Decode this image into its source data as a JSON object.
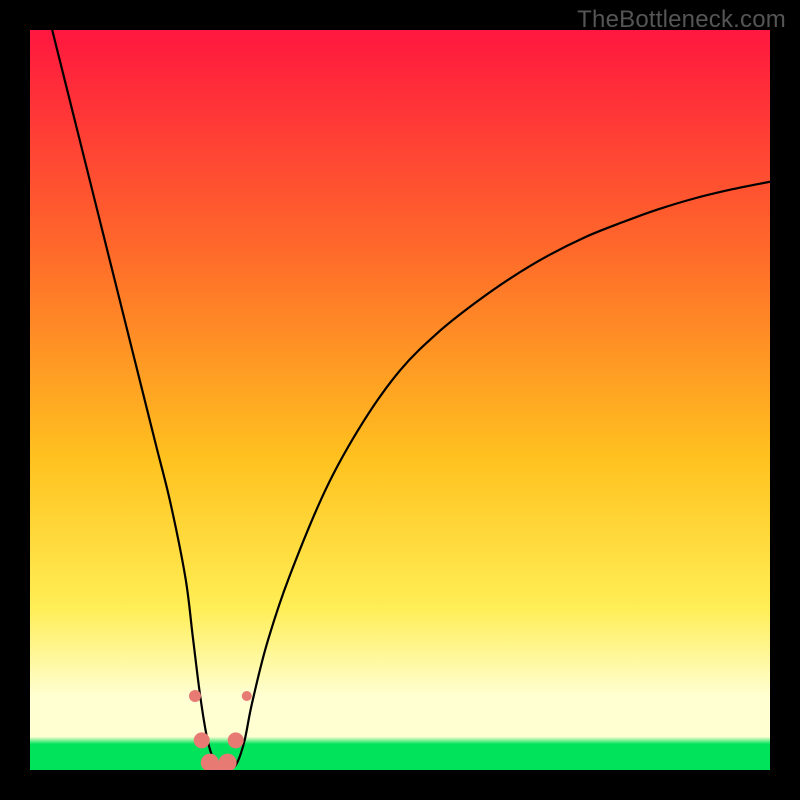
{
  "watermark": "TheBottleneck.com",
  "colors": {
    "frame": "#000000",
    "grad_top": "#ff173f",
    "grad_upper_mid": "#ff6a2a",
    "grad_mid": "#ffc21f",
    "grad_lower_mid": "#ffee55",
    "grad_pale": "#ffffd2",
    "grad_green": "#00e35b",
    "curve": "#000000",
    "marker_fill": "#e77b74",
    "marker_stroke": "#d8645c"
  },
  "chart_data": {
    "type": "line",
    "title": "",
    "xlabel": "",
    "ylabel": "",
    "xlim": [
      0,
      100
    ],
    "ylim": [
      0,
      100
    ],
    "series": [
      {
        "name": "bottleneck-curve",
        "x": [
          3,
          5,
          7,
          9,
          11,
          13,
          15,
          17,
          19,
          21,
          22,
          23,
          24,
          25,
          26,
          27,
          28,
          29,
          30,
          32,
          35,
          40,
          45,
          50,
          55,
          60,
          65,
          70,
          75,
          80,
          85,
          90,
          95,
          100
        ],
        "y": [
          100,
          92,
          84,
          76,
          68,
          60,
          52,
          44,
          36,
          26,
          18,
          10,
          4,
          1,
          0,
          0,
          1,
          4,
          9,
          17,
          26,
          38,
          47,
          54,
          59,
          63,
          66.5,
          69.5,
          72,
          74,
          75.8,
          77.3,
          78.5,
          79.5
        ]
      }
    ],
    "markers": {
      "name": "highlighted-range",
      "x_center": 25.5,
      "points": [
        {
          "x": 22.3,
          "y": 10,
          "r": 6
        },
        {
          "x": 23.2,
          "y": 4,
          "r": 8
        },
        {
          "x": 24.3,
          "y": 1,
          "r": 9
        },
        {
          "x": 25.5,
          "y": 0,
          "r": 9
        },
        {
          "x": 26.7,
          "y": 1,
          "r": 9
        },
        {
          "x": 27.8,
          "y": 4,
          "r": 8
        },
        {
          "x": 29.3,
          "y": 10,
          "r": 5
        }
      ]
    },
    "gradient_stops": [
      {
        "pos": 0.0,
        "key": "grad_top"
      },
      {
        "pos": 0.3,
        "key": "grad_upper_mid"
      },
      {
        "pos": 0.58,
        "key": "grad_mid"
      },
      {
        "pos": 0.78,
        "key": "grad_lower_mid"
      },
      {
        "pos": 0.9,
        "key": "grad_pale"
      },
      {
        "pos": 0.955,
        "key": "grad_pale"
      },
      {
        "pos": 0.965,
        "key": "grad_green"
      },
      {
        "pos": 1.0,
        "key": "grad_green"
      }
    ]
  }
}
